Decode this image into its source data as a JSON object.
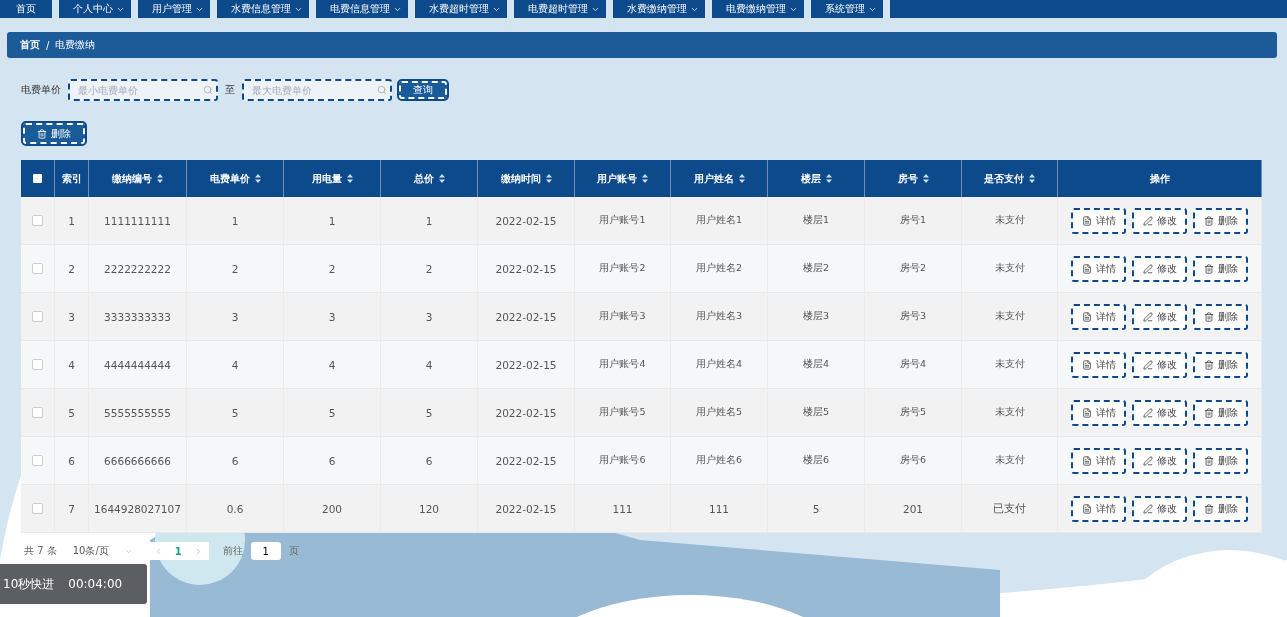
{
  "nav": [
    {
      "label": "首页",
      "dropdown": false
    },
    {
      "label": "个人中心",
      "dropdown": true
    },
    {
      "label": "用户管理",
      "dropdown": true
    },
    {
      "label": "水费信息管理",
      "dropdown": true
    },
    {
      "label": "电费信息管理",
      "dropdown": true
    },
    {
      "label": "水费超时管理",
      "dropdown": true
    },
    {
      "label": "电费超时管理",
      "dropdown": true
    },
    {
      "label": "水费缴纳管理",
      "dropdown": true
    },
    {
      "label": "电费缴纳管理",
      "dropdown": true
    },
    {
      "label": "系统管理",
      "dropdown": true
    }
  ],
  "breadcrumb": {
    "home": "首页",
    "separator": "/",
    "current": "电费缴纳"
  },
  "filter": {
    "label": "电费单价",
    "min_placeholder": "最小电费单价",
    "to": "至",
    "max_placeholder": "最大电费单价",
    "search_button": "查询"
  },
  "delete_button": "删除",
  "table": {
    "columns": [
      {
        "label": "索引",
        "sortable": false
      },
      {
        "label": "缴纳编号",
        "sortable": true
      },
      {
        "label": "电费单价",
        "sortable": true
      },
      {
        "label": "用电量",
        "sortable": true
      },
      {
        "label": "总价",
        "sortable": true
      },
      {
        "label": "缴纳时间",
        "sortable": true
      },
      {
        "label": "用户账号",
        "sortable": true
      },
      {
        "label": "用户姓名",
        "sortable": true
      },
      {
        "label": "楼层",
        "sortable": true
      },
      {
        "label": "房号",
        "sortable": true
      },
      {
        "label": "是否支付",
        "sortable": true
      },
      {
        "label": "操作",
        "sortable": false
      }
    ],
    "select_all_checked": false,
    "rows": [
      {
        "checked": false,
        "cells": [
          "1",
          "1111111111",
          "1",
          "1",
          "1",
          "2022-02-15",
          "用户账号1",
          "用户姓名1",
          "楼层1",
          "房号1",
          "未支付"
        ],
        "actions": [
          "详情",
          "修改",
          "删除"
        ]
      },
      {
        "checked": false,
        "cells": [
          "2",
          "2222222222",
          "2",
          "2",
          "2",
          "2022-02-15",
          "用户账号2",
          "用户姓名2",
          "楼层2",
          "房号2",
          "未支付"
        ],
        "actions": [
          "详情",
          "修改",
          "删除"
        ]
      },
      {
        "checked": false,
        "cells": [
          "3",
          "3333333333",
          "3",
          "3",
          "3",
          "2022-02-15",
          "用户账号3",
          "用户姓名3",
          "楼层3",
          "房号3",
          "未支付"
        ],
        "actions": [
          "详情",
          "修改",
          "删除"
        ]
      },
      {
        "checked": false,
        "cells": [
          "4",
          "4444444444",
          "4",
          "4",
          "4",
          "2022-02-15",
          "用户账号4",
          "用户姓名4",
          "楼层4",
          "房号4",
          "未支付"
        ],
        "actions": [
          "详情",
          "修改",
          "删除"
        ]
      },
      {
        "checked": false,
        "cells": [
          "5",
          "5555555555",
          "5",
          "5",
          "5",
          "2022-02-15",
          "用户账号5",
          "用户姓名5",
          "楼层5",
          "房号5",
          "未支付"
        ],
        "actions": [
          "详情",
          "修改",
          "删除"
        ]
      },
      {
        "checked": false,
        "cells": [
          "6",
          "6666666666",
          "6",
          "6",
          "6",
          "2022-02-15",
          "用户账号6",
          "用户姓名6",
          "楼层6",
          "房号6",
          "未支付"
        ],
        "actions": [
          "详情",
          "修改",
          "删除"
        ]
      },
      {
        "checked": false,
        "cells": [
          "7",
          "1644928027107",
          "0.6",
          "200",
          "120",
          "2022-02-15",
          "111",
          "111",
          "5",
          "201",
          "已支付"
        ],
        "actions": [
          "详情",
          "修改",
          "删除"
        ]
      }
    ]
  },
  "pagination": {
    "total": "共 7 条",
    "page_size": "10条/页",
    "pages": [
      {
        "label": "1",
        "selected": true
      }
    ],
    "goto_label": "前往",
    "goto_value": "1",
    "goto_unit": "页"
  },
  "overlay": {
    "label": "10秒快进",
    "time": "00:04:00"
  }
}
